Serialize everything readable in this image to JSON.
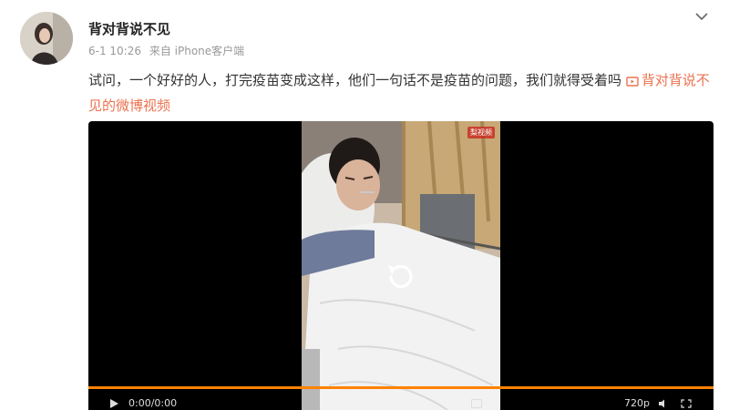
{
  "post": {
    "author": "背对背说不见",
    "date": "6-1 10:26",
    "source": "来自 iPhone客户端",
    "text": "试问，一个好好的人，打完疫苗变成这样，他们一句话不是疫苗的问题，我们就得受着吗",
    "video_link_label": "背对背说不见的微博视频"
  },
  "video": {
    "watermark": "梨视频",
    "elapsed": "0:00",
    "duration": "0:00",
    "quality": "720p",
    "progress_fraction": 1.0
  },
  "colors": {
    "accent": "#eb7350",
    "progress": "#ff8200",
    "player_bg": "#000000"
  },
  "icons": {
    "chevron": "chevron-down-icon",
    "video": "video-icon",
    "replay": "replay-icon",
    "play": "play-icon"
  }
}
